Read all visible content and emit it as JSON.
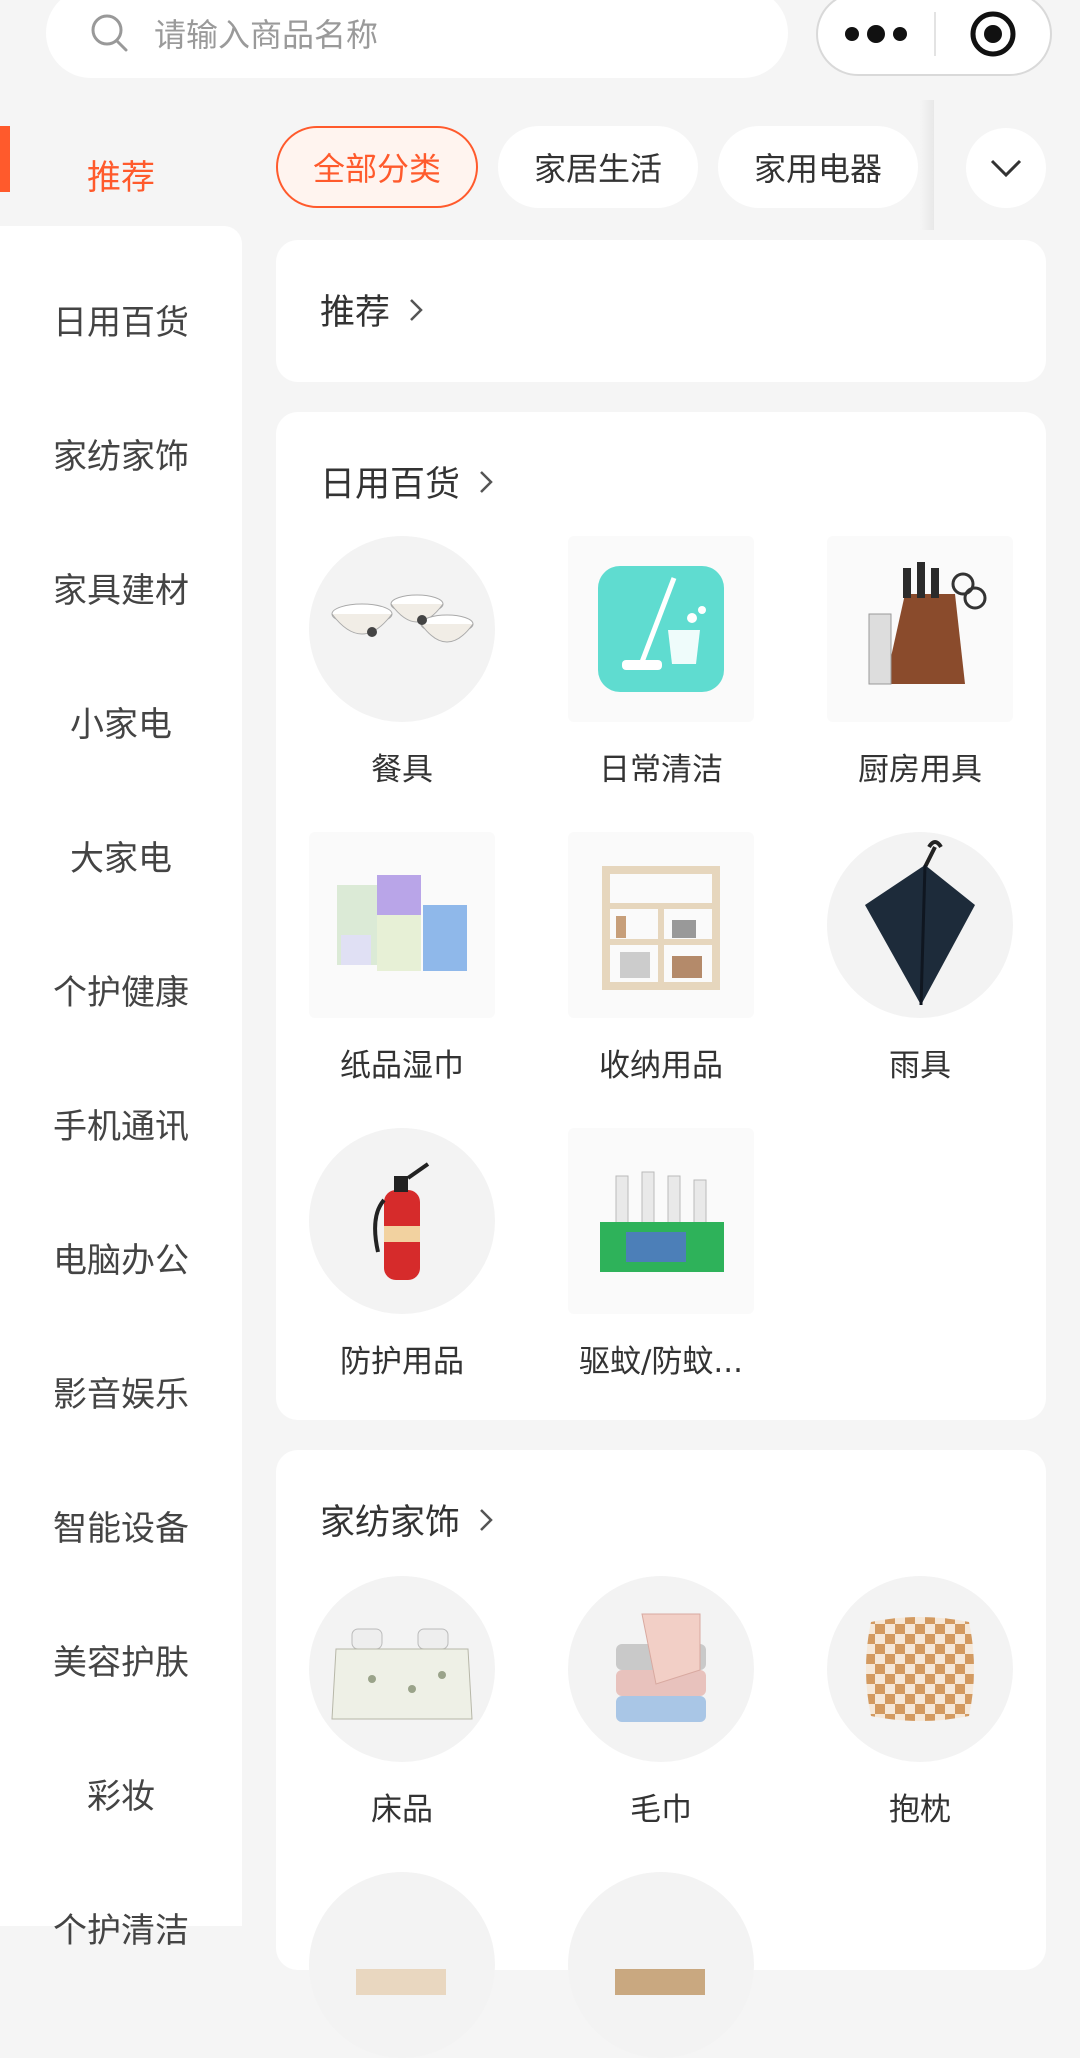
{
  "search": {
    "placeholder": "请输入商品名称"
  },
  "sidebar": {
    "active": "推荐",
    "items": [
      "日用百货",
      "家纺家饰",
      "家具建材",
      "小家电",
      "大家电",
      "个护健康",
      "手机通讯",
      "电脑办公",
      "影音娱乐",
      "智能设备",
      "美容护肤",
      "彩妆",
      "个护清洁"
    ]
  },
  "chips": [
    "全部分类",
    "家居生活",
    "家用电器"
  ],
  "sections": [
    {
      "title": "推荐",
      "items": []
    },
    {
      "title": "日用百货",
      "items": [
        {
          "label": "餐具",
          "icon": "tableware-icon"
        },
        {
          "label": "日常清洁",
          "icon": "mop-bucket-icon"
        },
        {
          "label": "厨房用具",
          "icon": "knife-block-icon"
        },
        {
          "label": "纸品湿巾",
          "icon": "tissue-packs-icon"
        },
        {
          "label": "收纳用品",
          "icon": "shelf-icon"
        },
        {
          "label": "雨具",
          "icon": "umbrella-icon"
        },
        {
          "label": "防护用品",
          "icon": "fire-extinguisher-icon"
        },
        {
          "label": "驱蚊/防蚊...",
          "icon": "mosquito-repellent-icon"
        }
      ]
    },
    {
      "title": "家纺家饰",
      "items": [
        {
          "label": "床品",
          "icon": "bedding-icon"
        },
        {
          "label": "毛巾",
          "icon": "towel-icon"
        },
        {
          "label": "抱枕",
          "icon": "pillow-icon"
        }
      ]
    }
  ],
  "colors": {
    "accent": "#ff5a2c",
    "background": "#f5f5f5"
  }
}
